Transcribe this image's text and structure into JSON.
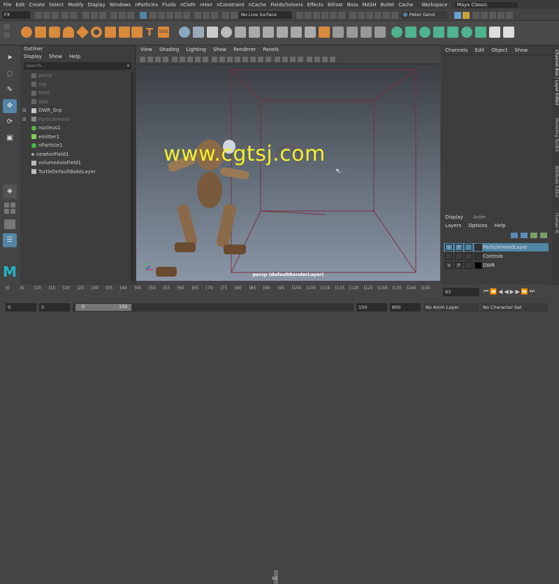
{
  "menubar": {
    "items": [
      "File",
      "Edit",
      "Create",
      "Select",
      "Modify",
      "Display",
      "Windows",
      "nParticles",
      "Fluids",
      "nCloth",
      "nHair",
      "nConstraint",
      "nCache",
      "Fields/Solvers",
      "Effects",
      "Bifrost",
      "Boss",
      "MASH",
      "Bullet",
      "Cache"
    ],
    "workspace_label": "Workspace :",
    "workspace_value": "Maya Classic"
  },
  "statusline": {
    "menuset": "FX",
    "live_surface": "No Live Surface",
    "user": "Peter Gend"
  },
  "outliner": {
    "title": "Outliner",
    "menus": [
      "Display",
      "Show",
      "Help"
    ],
    "search_placeholder": "Search...",
    "items": [
      {
        "label": "persp",
        "dim": true
      },
      {
        "label": "top",
        "dim": true
      },
      {
        "label": "front",
        "dim": true
      },
      {
        "label": "side",
        "dim": true
      },
      {
        "label": "DWR_Grp",
        "dim": false
      },
      {
        "label": "ParticleHand",
        "dim": true
      },
      {
        "label": "nucleus1",
        "dim": false
      },
      {
        "label": "emitter1",
        "dim": false
      },
      {
        "label": "nParticle1",
        "dim": false
      },
      {
        "label": "newtonField1",
        "dim": false
      },
      {
        "label": "volumeAxisField1",
        "dim": false
      },
      {
        "label": "TurtleDefaultBakeLayer",
        "dim": false
      }
    ]
  },
  "viewport": {
    "menus": [
      "View",
      "Shading",
      "Lighting",
      "Show",
      "Renderer",
      "Panels"
    ],
    "camera_label": "persp (defaultRenderLayer)"
  },
  "channelbox": {
    "menus": [
      "Channels",
      "Edit",
      "Object",
      "Show"
    ]
  },
  "side_tabs": [
    "Channel Box / Layer Editor",
    "Modeling Toolkit",
    "Attribute Editor",
    "Human IK"
  ],
  "layers": {
    "tabs": [
      "Display",
      "Anim"
    ],
    "menus": [
      "Layers",
      "Options",
      "Help"
    ],
    "rows": [
      {
        "v": "V",
        "p": "P",
        "name": "ParticleHandLayer",
        "selected": true
      },
      {
        "v": "",
        "p": "",
        "name": "Controls",
        "selected": false
      },
      {
        "v": "V",
        "p": "P",
        "name": "DWR",
        "selected": false
      }
    ]
  },
  "timeslider": {
    "ticks": [
      "0",
      "5",
      "10",
      "15",
      "20",
      "25",
      "30",
      "35",
      "40",
      "45",
      "50",
      "55",
      "60",
      "65",
      "70",
      "75",
      "80",
      "85",
      "90",
      "95",
      "100",
      "105",
      "110",
      "115",
      "120",
      "125",
      "130",
      "135",
      "140",
      "145"
    ],
    "current_marker": "93",
    "current_frame": "93"
  },
  "rangebar": {
    "start": "0",
    "start_inner": "0",
    "range_start": "0",
    "range_end": "150",
    "end_inner": "150",
    "end": "800",
    "anim_layer": "No Anim Layer",
    "character_set": "No Character Set"
  },
  "watermark": "www.cgtsj.com",
  "colors": {
    "accent_blue": "#5285a6",
    "watermark_yellow": "#f4ef2b"
  }
}
